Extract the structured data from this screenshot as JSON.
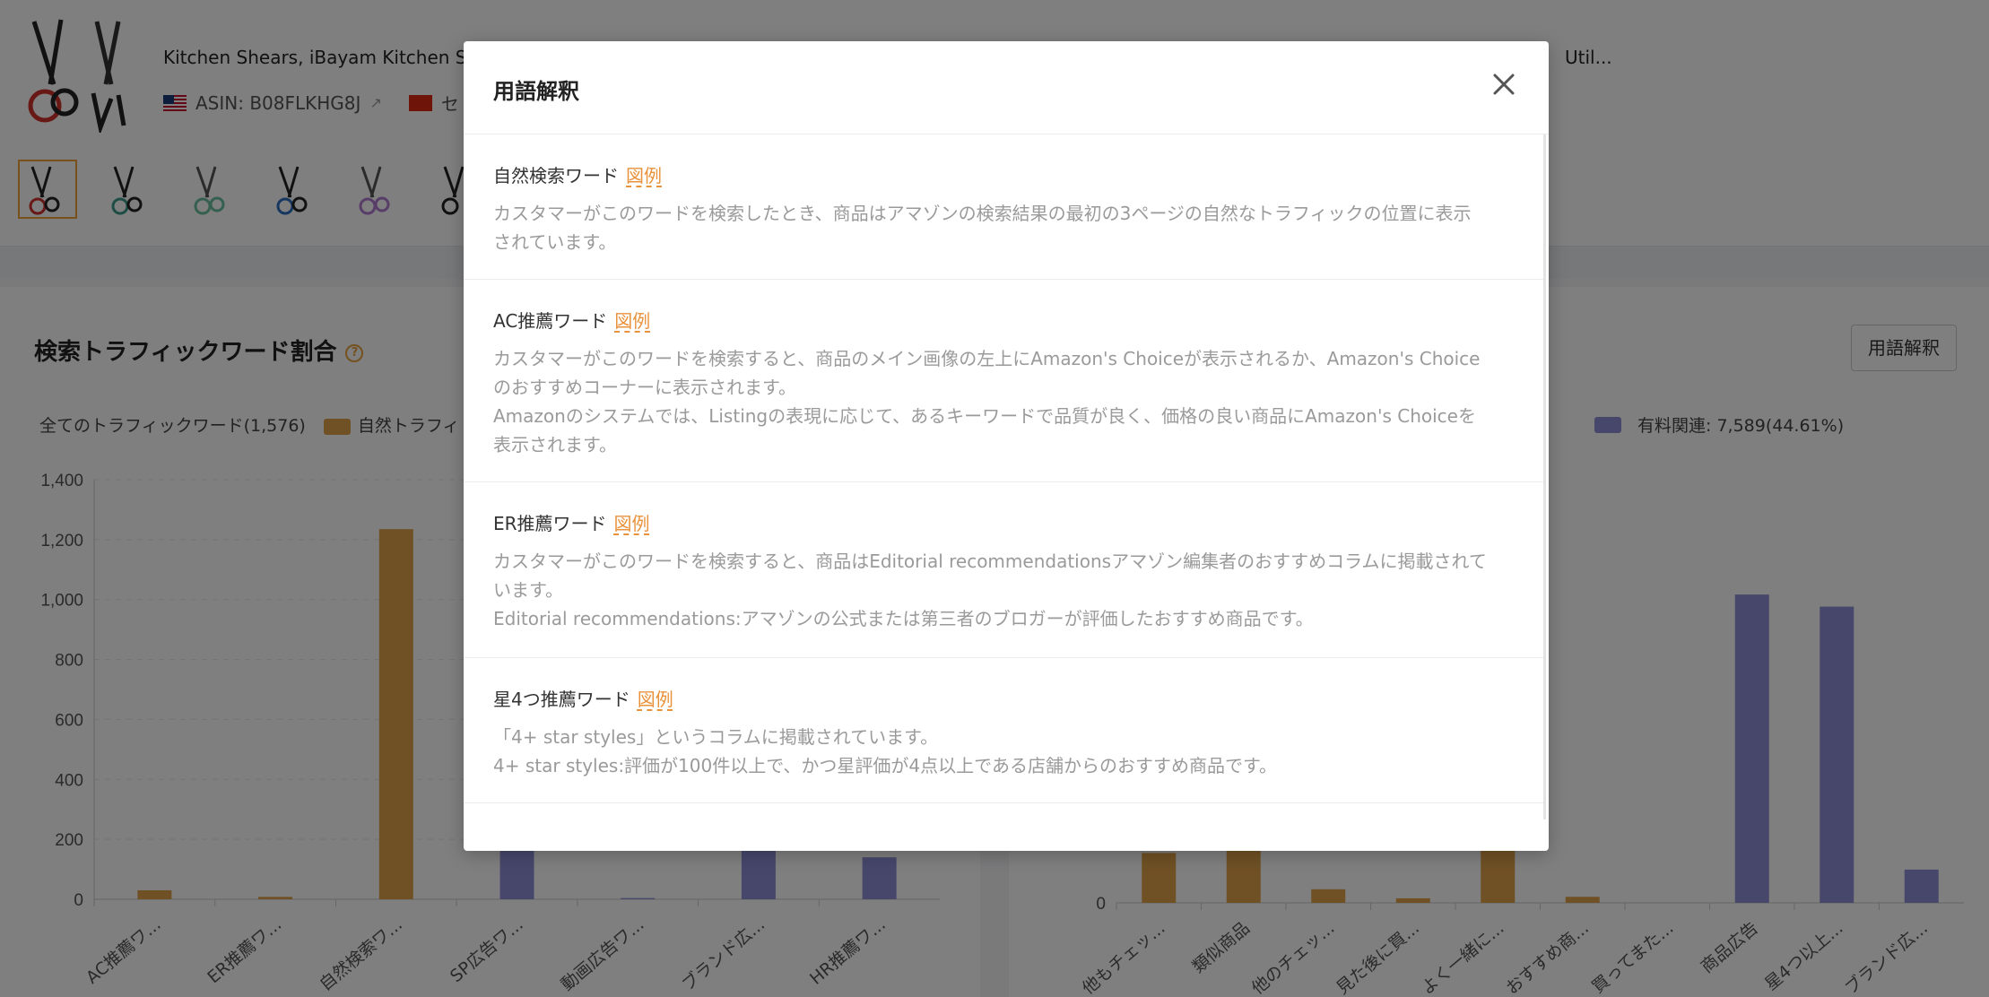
{
  "product": {
    "title": "Kitchen Shears, iBayam Kitchen S",
    "title_tail": "Util...",
    "asin": "ASIN: B08FLKHG8J",
    "seller_fragment": "セ"
  },
  "left_panel": {
    "title": "検索トラフィックワード割合",
    "legend_all": "全てのトラフィックワード(1,576)",
    "legend_natural": "自然トラフィ"
  },
  "right_panel": {
    "term_button": "用語解釈",
    "legend_paid": "有料関連: 7,589(44.61%)"
  },
  "colors": {
    "natural": "#e0a24a",
    "paid": "#8e8fd8"
  },
  "chart_data": [
    {
      "type": "bar",
      "title": "",
      "categories": [
        "AC推薦ワ...",
        "ER推薦ワ...",
        "自然検索ワ...",
        "SP広告ワ...",
        "動画広告ワ...",
        "ブランド広...",
        "HR推薦ワ..."
      ],
      "series": [
        {
          "values": [
            30,
            8,
            1235,
            0,
            0,
            0,
            0
          ]
        },
        {
          "values": [
            0,
            0,
            0,
            190,
            4,
            270,
            140
          ]
        }
      ],
      "ylim": [
        0,
        1400
      ],
      "yticks": [
        "0",
        "200",
        "400",
        "600",
        "800",
        "1,000",
        "1,200",
        "1,400"
      ]
    },
    {
      "type": "bar",
      "title": "",
      "categories": [
        "他もチェッ...",
        "類似商品",
        "他のチェッ...",
        "見た後に買...",
        "よく一緒に...",
        "おすすめ商...",
        "買ってまた...",
        "商品広告",
        "星4つ以上...",
        "ブランド広..."
      ],
      "series": [
        {
          "values": [
            165,
            195,
            45,
            15,
            260,
            20,
            0,
            0,
            0,
            0
          ]
        },
        {
          "values": [
            0,
            0,
            0,
            0,
            0,
            0,
            0,
            1020,
            980,
            110
          ]
        }
      ],
      "yticks": [
        "0"
      ]
    }
  ],
  "modal": {
    "title": "用語解釈",
    "example_label": "図例",
    "sections": [
      {
        "name": "自然検索ワード",
        "lines": [
          "カスタマーがこのワードを検索したとき、商品はアマゾンの検索結果の最初の3ページの自然なトラフィックの位置に表示",
          "されています。"
        ]
      },
      {
        "name": "AC推薦ワード",
        "lines": [
          "カスタマーがこのワードを検索すると、商品のメイン画像の左上にAmazon's Choiceが表示されるか、Amazon's Choice",
          "のおすすめコーナーに表示されます。",
          "Amazonのシステムでは、Listingの表現に応じて、あるキーワードで品質が良く、価格の良い商品にAmazon's Choiceを",
          "表示されます。"
        ]
      },
      {
        "name": "ER推薦ワード",
        "lines": [
          "カスタマーがこのワードを検索すると、商品はEditorial recommendationsアマゾン編集者のおすすめコラムに掲載されて",
          "います。",
          "Editorial recommendations:アマゾンの公式または第三者のブロガーが評価したおすすめ商品です。"
        ]
      },
      {
        "name": "星4つ推薦ワード",
        "lines": [
          "「4+ star styles」というコラムに掲載されています。",
          "4+ star styles:評価が100件以上で、かつ星評価が4点以上である店舗からのおすすめ商品です。"
        ]
      }
    ]
  }
}
